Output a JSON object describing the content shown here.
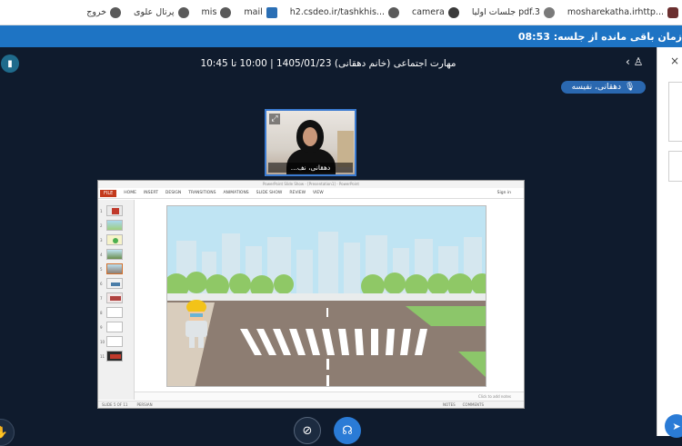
{
  "bookmarks": [
    {
      "label": "mosharekatha.irhttp...",
      "icon": "bookmark-site-icon"
    },
    {
      "label": "جلسات اولیا pdf.3",
      "icon": "pdf-icon"
    },
    {
      "label": "camera",
      "icon": "camera-icon"
    },
    {
      "label": "h2.csdeo.ir/tashkhis...",
      "icon": "globe-icon"
    },
    {
      "label": "mail",
      "icon": "mail-icon"
    },
    {
      "label": "mis",
      "icon": "globe-icon"
    },
    {
      "label": "پرتال علوی",
      "icon": "globe-icon"
    },
    {
      "label": "خروج",
      "icon": "globe-icon"
    }
  ],
  "banner": {
    "text": "زمان باقی مانده از جلسه: 08:53"
  },
  "meeting": {
    "title": "مهارت اجتماعی (خانم دهقانی) 1405/01/23 | 10:00 تا 10:45"
  },
  "presenter": {
    "name": "دهقانی، نفیسه",
    "icon": "microphone-icon"
  },
  "webcam": {
    "label": "دهقانی، نف..."
  },
  "presentation": {
    "window_title": "PowerPoint Slide Show - [Presentation1] - PowerPoint",
    "file_tab": "FILE",
    "tabs": [
      "HOME",
      "INSERT",
      "DESIGN",
      "TRANSITIONS",
      "ANIMATIONS",
      "SLIDE SHOW",
      "REVIEW",
      "VIEW"
    ],
    "signin": "Sign in",
    "thumb_numbers": [
      "1",
      "2",
      "3",
      "4",
      "5",
      "6",
      "7",
      "8",
      "9",
      "10",
      "11"
    ],
    "notes_placeholder": "Click to add notes",
    "status_left": "SLIDE 5 OF 11",
    "status_lang": "PERSIAN",
    "status_notes": "NOTES",
    "status_comments": "COMMENTS"
  },
  "colors": {
    "banner": "#1e74c4",
    "stage": "#0f1b2d",
    "accent": "#2a68b0"
  }
}
